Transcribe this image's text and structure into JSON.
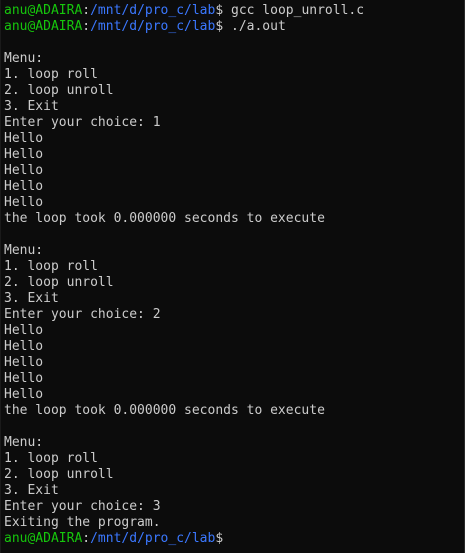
{
  "prompt": {
    "user_host": "anu@ADAIRA",
    "separator": ":",
    "path": "/mnt/d/pro_c/lab",
    "symbol": "$"
  },
  "lines": [
    {
      "kind": "cmd",
      "text": " gcc loop_unroll.c"
    },
    {
      "kind": "cmd",
      "text": " ./a.out"
    },
    {
      "kind": "out",
      "text": ""
    },
    {
      "kind": "out",
      "text": "Menu:"
    },
    {
      "kind": "out",
      "text": "1. loop roll"
    },
    {
      "kind": "out",
      "text": "2. loop unroll"
    },
    {
      "kind": "out",
      "text": "3. Exit"
    },
    {
      "kind": "out",
      "text": "Enter your choice: 1"
    },
    {
      "kind": "out",
      "text": "Hello"
    },
    {
      "kind": "out",
      "text": "Hello"
    },
    {
      "kind": "out",
      "text": "Hello"
    },
    {
      "kind": "out",
      "text": "Hello"
    },
    {
      "kind": "out",
      "text": "Hello"
    },
    {
      "kind": "out",
      "text": "the loop took 0.000000 seconds to execute"
    },
    {
      "kind": "out",
      "text": ""
    },
    {
      "kind": "out",
      "text": "Menu:"
    },
    {
      "kind": "out",
      "text": "1. loop roll"
    },
    {
      "kind": "out",
      "text": "2. loop unroll"
    },
    {
      "kind": "out",
      "text": "3. Exit"
    },
    {
      "kind": "out",
      "text": "Enter your choice: 2"
    },
    {
      "kind": "out",
      "text": "Hello"
    },
    {
      "kind": "out",
      "text": "Hello"
    },
    {
      "kind": "out",
      "text": "Hello"
    },
    {
      "kind": "out",
      "text": "Hello"
    },
    {
      "kind": "out",
      "text": "Hello"
    },
    {
      "kind": "out",
      "text": "the loop took 0.000000 seconds to execute"
    },
    {
      "kind": "out",
      "text": ""
    },
    {
      "kind": "out",
      "text": "Menu:"
    },
    {
      "kind": "out",
      "text": "1. loop roll"
    },
    {
      "kind": "out",
      "text": "2. loop unroll"
    },
    {
      "kind": "out",
      "text": "3. Exit"
    },
    {
      "kind": "out",
      "text": "Enter your choice: 3"
    },
    {
      "kind": "out",
      "text": "Exiting the program."
    },
    {
      "kind": "cmd",
      "text": ""
    }
  ],
  "colors": {
    "background": "#0c0c0c",
    "text": "#cccccc",
    "user_host": "#16c60c",
    "path": "#3b78ff"
  }
}
